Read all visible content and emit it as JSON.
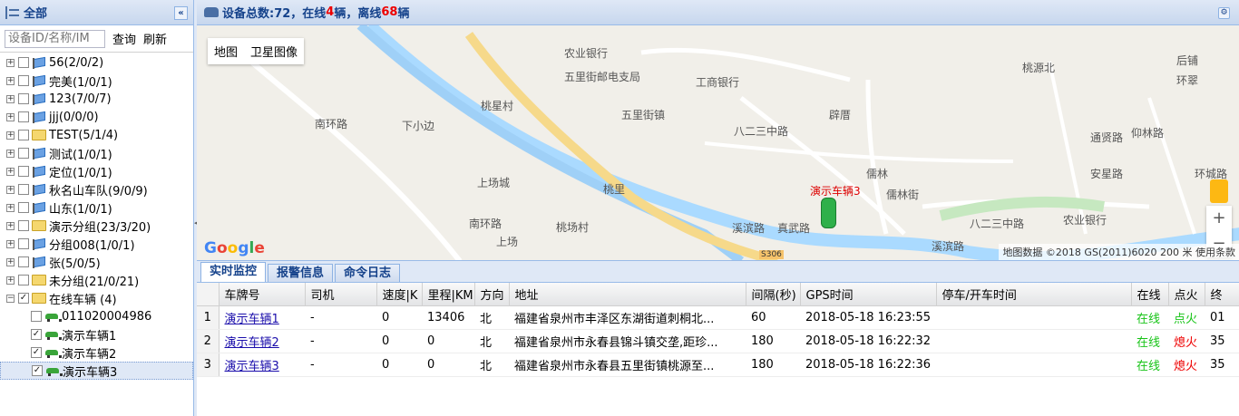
{
  "tree": {
    "title": "全部",
    "search_placeholder": "设备ID/名称/IM",
    "query_label": "查询",
    "refresh_label": "刷新",
    "groups": [
      {
        "label": "56(2/0/2)",
        "type": "flag"
      },
      {
        "label": "完美(1/0/1)",
        "type": "flag"
      },
      {
        "label": "123(7/0/7)",
        "type": "flag"
      },
      {
        "label": "jjj(0/0/0)",
        "type": "flag"
      },
      {
        "label": "TEST(5/1/4)",
        "type": "folder"
      },
      {
        "label": "测试(1/0/1)",
        "type": "flag"
      },
      {
        "label": "定位(1/0/1)",
        "type": "flag"
      },
      {
        "label": "秋名山车队(9/0/9)",
        "type": "flag"
      },
      {
        "label": "山东(1/0/1)",
        "type": "flag"
      },
      {
        "label": "演示分组(23/3/20)",
        "type": "folder"
      },
      {
        "label": "分组008(1/0/1)",
        "type": "flag"
      },
      {
        "label": "张(5/0/5)",
        "type": "flag"
      },
      {
        "label": "未分组(21/0/21)",
        "type": "folder"
      },
      {
        "label": "在线车辆 (4)",
        "type": "folder"
      }
    ],
    "online_vehicles": [
      {
        "label": "011020004986",
        "checked": false
      },
      {
        "label": "演示车辆1",
        "checked": true
      },
      {
        "label": "演示车辆2",
        "checked": true
      },
      {
        "label": "演示车辆3",
        "checked": true
      }
    ]
  },
  "header": {
    "prefix": "设备总数:72，在线",
    "online": "4",
    "middle": "辆，离线",
    "offline": "68",
    "suffix": "辆"
  },
  "map": {
    "type_map": "地图",
    "type_satellite": "卫星图像",
    "vehicle_label": "演示车辆3",
    "attribution": "地图数据 ©2018 GS(2011)6020   200 米         使用条款",
    "google": "Google",
    "places": [
      "农业银行",
      "五里街邮电支局",
      "工商银行",
      "桃源北",
      "五里街镇",
      "桃星村",
      "下小边",
      "南环路",
      "辟厝",
      "八二三中路",
      "儒林",
      "儒林街",
      "上场城",
      "桃里",
      "桃场村",
      "上场",
      "溪滨路",
      "真武路",
      "八二三中路",
      "农业银行",
      "后铺",
      "环翠",
      "仰林路",
      "通贤路",
      "安星路",
      "环城路",
      "溪滨路",
      "S306",
      "南环路"
    ]
  },
  "tabs": [
    "实时监控",
    "报警信息",
    "命令日志"
  ],
  "table": {
    "columns": [
      "车牌号",
      "司机",
      "速度|K",
      "里程|KM",
      "方向",
      "地址",
      "间隔(秒)",
      "GPS时间",
      "停车/开车时间",
      "在线",
      "点火",
      "终"
    ],
    "rows": [
      {
        "no": "1",
        "plate": "演示车辆1",
        "driver": "-",
        "speed": "0",
        "mileage": "13406",
        "dir": "北",
        "addr": "福建省泉州市丰泽区东湖街道刺桐北...",
        "interval": "60",
        "gps": "2018-05-18 16:23:55",
        "park": "",
        "online": "在线",
        "ignition": "点火",
        "end": "01"
      },
      {
        "no": "2",
        "plate": "演示车辆2",
        "driver": "-",
        "speed": "0",
        "mileage": "0",
        "dir": "北",
        "addr": "福建省泉州市永春县锦斗镇交垄,距珍...",
        "interval": "180",
        "gps": "2018-05-18 16:22:32",
        "park": "",
        "online": "在线",
        "ignition": "熄火",
        "end": "35"
      },
      {
        "no": "3",
        "plate": "演示车辆3",
        "driver": "-",
        "speed": "0",
        "mileage": "0",
        "dir": "北",
        "addr": "福建省泉州市永春县五里街镇桃源至...",
        "interval": "180",
        "gps": "2018-05-18 16:22:36",
        "park": "",
        "online": "在线",
        "ignition": "熄火",
        "end": "35"
      }
    ]
  },
  "colors": {
    "online": "#17c417",
    "offline": "#e00000",
    "header_text": "#15428b"
  }
}
